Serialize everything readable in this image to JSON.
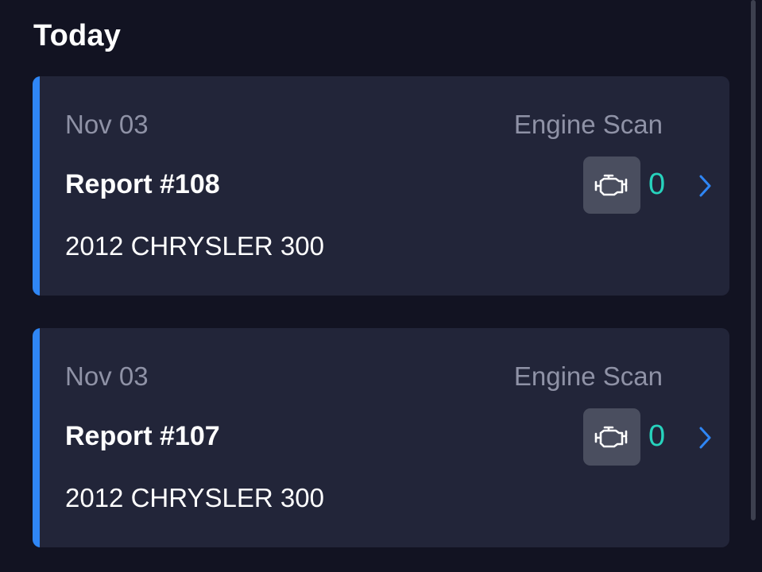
{
  "section": {
    "title": "Today"
  },
  "reports": [
    {
      "date": "Nov 03",
      "type": "Engine Scan",
      "title": "Report #108",
      "vehicle": "2012 CHRYSLER 300",
      "code_count": "0",
      "icon": "engine-icon"
    },
    {
      "date": "Nov 03",
      "type": "Engine Scan",
      "title": "Report #107",
      "vehicle": "2012 CHRYSLER 300",
      "code_count": "0",
      "icon": "engine-icon"
    }
  ],
  "colors": {
    "background": "#121322",
    "card": "#222539",
    "accent": "#2f86f5",
    "count": "#27d3bd",
    "muted_text": "#8f92a6"
  }
}
